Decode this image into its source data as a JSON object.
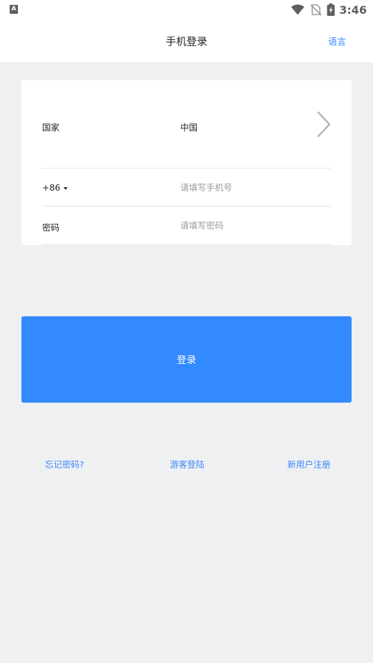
{
  "status_bar": {
    "notification_icon_letter": "A",
    "time": "3:46",
    "icons": [
      "wifi-icon",
      "no-sim-icon",
      "battery-charging-icon"
    ]
  },
  "header": {
    "title": "手机登录",
    "language_label": "语言"
  },
  "form": {
    "country_label": "国家",
    "country_value": "中国",
    "country_code": "+86",
    "phone_placeholder": "请填写手机号",
    "password_label": "密码",
    "password_placeholder": "请填写密码"
  },
  "login_button_label": "登录",
  "links": {
    "forgot_password": "忘记密码?",
    "guest_login": "游客登陆",
    "new_user_register": "新用户注册"
  },
  "colors": {
    "accent": "#3389fe",
    "link": "#3a88fd",
    "background": "#eff0f2"
  }
}
